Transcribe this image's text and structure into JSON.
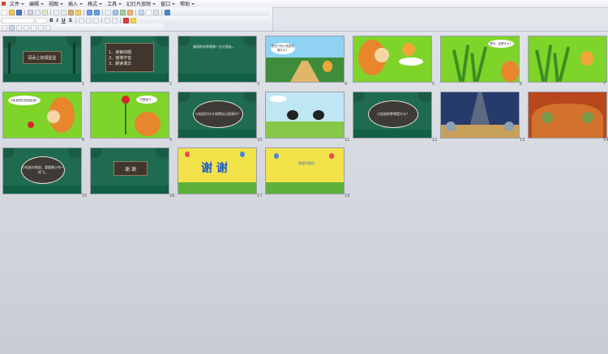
{
  "menubar": {
    "items": [
      {
        "label": "文件"
      },
      {
        "label": "编辑"
      },
      {
        "label": "视图"
      },
      {
        "label": "插入"
      },
      {
        "label": "格式"
      },
      {
        "label": "工具"
      },
      {
        "label": "幻灯片放映"
      },
      {
        "label": "窗口"
      },
      {
        "label": "帮助"
      }
    ]
  },
  "toolbar": {
    "bold": "B",
    "italic": "I",
    "underline": "U",
    "shadow": "S"
  },
  "slides": [
    {
      "number": "1",
      "title": "耳朵上的绿星星"
    },
    {
      "number": "2",
      "lines": [
        "1、读第四题",
        "2、读准字音",
        "3、朗读课文"
      ]
    },
    {
      "number": "3",
      "text": "美丽的花草就像一位大朋友。"
    },
    {
      "number": "4",
      "text": "阳光下的小松鼠在做什么？"
    },
    {
      "number": "5",
      "text": ""
    },
    {
      "number": "6",
      "text": "提问：这是什么？"
    },
    {
      "number": "7",
      "text": ""
    },
    {
      "number": "8",
      "text": "小松鼠把礼物送给谁？"
    },
    {
      "number": "9",
      "text": "它很高兴。"
    },
    {
      "number": "10",
      "text": "小松鼠为什么觉得自己很高兴？"
    },
    {
      "number": "11",
      "text": ""
    },
    {
      "number": "12",
      "text": "小松鼠的梦想是什么？"
    },
    {
      "number": "13",
      "text": ""
    },
    {
      "number": "14",
      "text": ""
    },
    {
      "number": "15",
      "text": "小松鼠对他说，我要像小鸟一样飞。"
    },
    {
      "number": "16",
      "title": "谢 谢"
    },
    {
      "number": "17",
      "title": "谢 谢"
    },
    {
      "number": "18",
      "text": "同学们再见"
    }
  ]
}
